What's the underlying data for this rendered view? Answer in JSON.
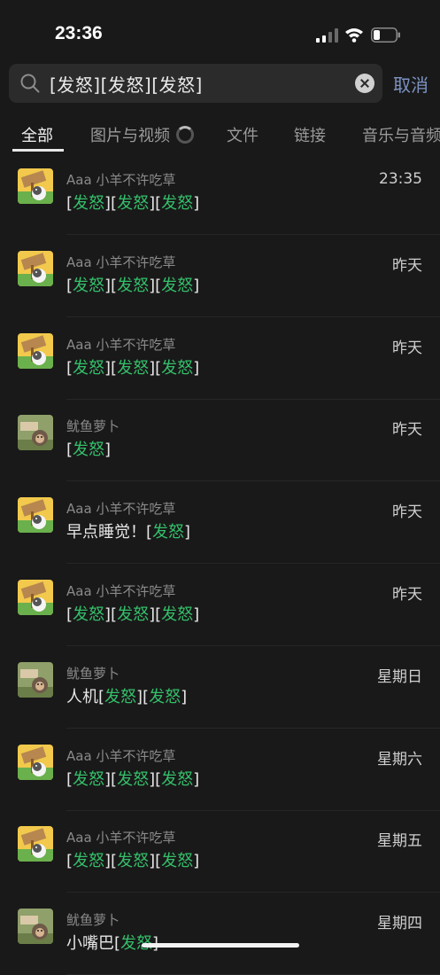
{
  "status": {
    "time": "23:36"
  },
  "search": {
    "query": "[发怒][发怒][发怒]",
    "cancel_label": "取消"
  },
  "tabs": [
    {
      "label": "全部",
      "active": true
    },
    {
      "label": "图片与视频",
      "active": false
    },
    {
      "label": "文件",
      "active": false
    },
    {
      "label": "链接",
      "active": false
    },
    {
      "label": "音乐与音频",
      "active": false
    }
  ],
  "results": [
    {
      "name": "Aaa 小羊不许吃草",
      "date": "23:35",
      "avatar": "sheep-avatar",
      "message": [
        {
          "t": "[",
          "h": false
        },
        {
          "t": "发怒",
          "h": true
        },
        {
          "t": "][",
          "h": false
        },
        {
          "t": "发怒",
          "h": true
        },
        {
          "t": "][",
          "h": false
        },
        {
          "t": "发怒",
          "h": true
        },
        {
          "t": "]",
          "h": false
        }
      ]
    },
    {
      "name": "Aaa 小羊不许吃草",
      "date": "昨天",
      "avatar": "sheep-avatar",
      "message": [
        {
          "t": "[",
          "h": false
        },
        {
          "t": "发怒",
          "h": true
        },
        {
          "t": "][",
          "h": false
        },
        {
          "t": "发怒",
          "h": true
        },
        {
          "t": "][",
          "h": false
        },
        {
          "t": "发怒",
          "h": true
        },
        {
          "t": "]",
          "h": false
        }
      ]
    },
    {
      "name": "Aaa 小羊不许吃草",
      "date": "昨天",
      "avatar": "sheep-avatar",
      "message": [
        {
          "t": "[",
          "h": false
        },
        {
          "t": "发怒",
          "h": true
        },
        {
          "t": "][",
          "h": false
        },
        {
          "t": "发怒",
          "h": true
        },
        {
          "t": "][",
          "h": false
        },
        {
          "t": "发怒",
          "h": true
        },
        {
          "t": "]",
          "h": false
        }
      ]
    },
    {
      "name": "鱿鱼萝卜",
      "date": "昨天",
      "avatar": "monkey-avatar",
      "message": [
        {
          "t": "[",
          "h": false
        },
        {
          "t": "发怒",
          "h": true
        },
        {
          "t": "]",
          "h": false
        }
      ]
    },
    {
      "name": "Aaa 小羊不许吃草",
      "date": "昨天",
      "avatar": "sheep-avatar",
      "message": [
        {
          "t": "早点睡觉！[",
          "h": false
        },
        {
          "t": "发怒",
          "h": true
        },
        {
          "t": "]",
          "h": false
        }
      ]
    },
    {
      "name": "Aaa 小羊不许吃草",
      "date": "昨天",
      "avatar": "sheep-avatar",
      "message": [
        {
          "t": "[",
          "h": false
        },
        {
          "t": "发怒",
          "h": true
        },
        {
          "t": "][",
          "h": false
        },
        {
          "t": "发怒",
          "h": true
        },
        {
          "t": "][",
          "h": false
        },
        {
          "t": "发怒",
          "h": true
        },
        {
          "t": "]",
          "h": false
        }
      ]
    },
    {
      "name": "鱿鱼萝卜",
      "date": "星期日",
      "avatar": "monkey-avatar",
      "message": [
        {
          "t": "人机[",
          "h": false
        },
        {
          "t": "发怒",
          "h": true
        },
        {
          "t": "][",
          "h": false
        },
        {
          "t": "发怒",
          "h": true
        },
        {
          "t": "]",
          "h": false
        }
      ]
    },
    {
      "name": "Aaa 小羊不许吃草",
      "date": "星期六",
      "avatar": "sheep-avatar",
      "message": [
        {
          "t": "[",
          "h": false
        },
        {
          "t": "发怒",
          "h": true
        },
        {
          "t": "][",
          "h": false
        },
        {
          "t": "发怒",
          "h": true
        },
        {
          "t": "][",
          "h": false
        },
        {
          "t": "发怒",
          "h": true
        },
        {
          "t": "]",
          "h": false
        }
      ]
    },
    {
      "name": "Aaa 小羊不许吃草",
      "date": "星期五",
      "avatar": "sheep-avatar",
      "message": [
        {
          "t": "[",
          "h": false
        },
        {
          "t": "发怒",
          "h": true
        },
        {
          "t": "][",
          "h": false
        },
        {
          "t": "发怒",
          "h": true
        },
        {
          "t": "][",
          "h": false
        },
        {
          "t": "发怒",
          "h": true
        },
        {
          "t": "]",
          "h": false
        }
      ]
    },
    {
      "name": "鱿鱼萝卜",
      "date": "星期四",
      "avatar": "monkey-avatar",
      "message": [
        {
          "t": "小嘴巴[",
          "h": false
        },
        {
          "t": "发怒",
          "h": true
        },
        {
          "t": "]",
          "h": false
        }
      ]
    }
  ],
  "colors": {
    "background": "#191919",
    "highlight": "#34bf6a",
    "cancel": "#7d93c3"
  }
}
